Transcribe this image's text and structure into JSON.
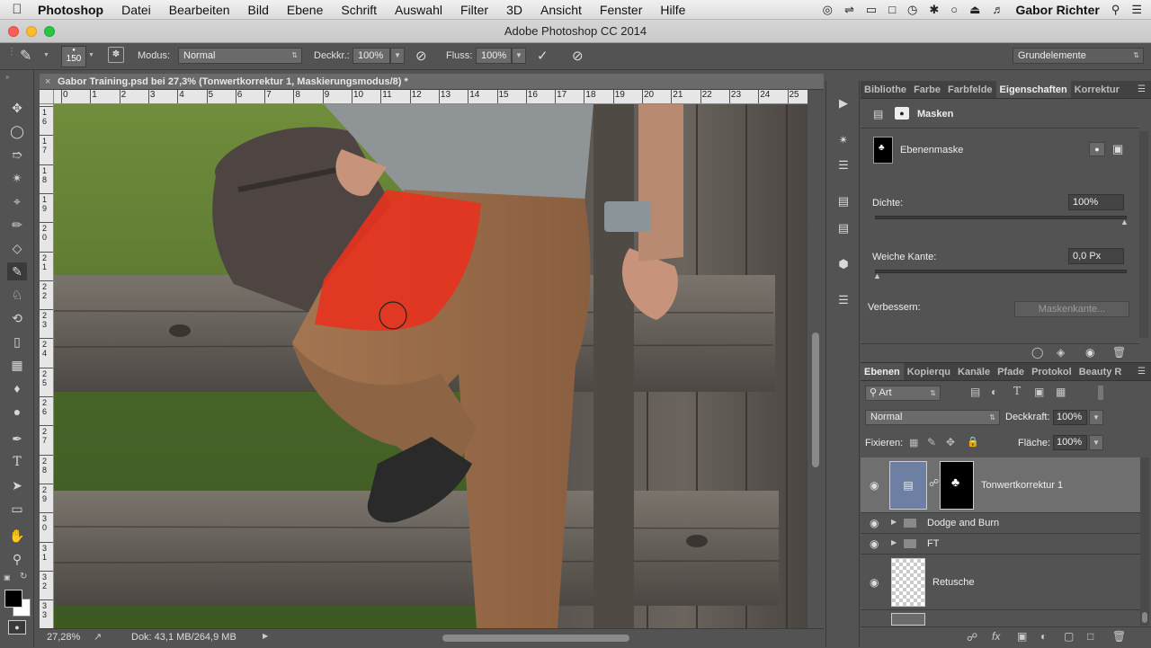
{
  "menubar": {
    "app": "Photoshop",
    "items": [
      "Datei",
      "Bearbeiten",
      "Bild",
      "Ebene",
      "Schrift",
      "Auswahl",
      "Filter",
      "3D",
      "Ansicht",
      "Fenster",
      "Hilfe"
    ],
    "user": "Gabor Richter"
  },
  "window": {
    "title": "Adobe Photoshop CC 2014"
  },
  "options": {
    "brush_size": "150",
    "modus_label": "Modus:",
    "modus_value": "Normal",
    "deckkr_label": "Deckkr.:",
    "deckkr_value": "100%",
    "fluss_label": "Fluss:",
    "fluss_value": "100%",
    "workspace": "Grundelemente"
  },
  "document": {
    "tab_title": "Gabor Training.psd bei 27,3% (Tonwertkorrektur 1, Maskierungsmodus/8) *",
    "ruler_h_labels": [
      "0",
      "1",
      "2",
      "3",
      "4",
      "5",
      "6",
      "7",
      "8",
      "9",
      "10",
      "11",
      "12",
      "13",
      "14",
      "15",
      "16",
      "17",
      "18",
      "19",
      "20",
      "21",
      "22",
      "23",
      "24",
      "25"
    ],
    "ruler_v_labels": [
      "16",
      "17",
      "18",
      "19",
      "20",
      "21",
      "22",
      "23",
      "24",
      "25",
      "26",
      "27",
      "28",
      "29",
      "30",
      "31",
      "32",
      "33"
    ]
  },
  "status": {
    "zoom": "27,28%",
    "doc": "Dok: 43,1 MB/264,9 MB"
  },
  "properties": {
    "tabs": [
      "Bibliothe",
      "Farbe",
      "Farbfelde",
      "Eigenschaften",
      "Korrektur"
    ],
    "active_tab": "Eigenschaften",
    "section": "Masken",
    "mask_label": "Ebenenmaske",
    "density_label": "Dichte:",
    "density_value": "100%",
    "density_fraction": 1.0,
    "feather_label": "Weiche Kante:",
    "feather_value": "0,0 Px",
    "feather_fraction": 0.0,
    "refine_label": "Verbessern:",
    "refine_button": "Maskenkante..."
  },
  "layers_panel": {
    "tabs": [
      "Ebenen",
      "Kopierqu",
      "Kanäle",
      "Pfade",
      "Protokol",
      "Beauty R"
    ],
    "active_tab": "Ebenen",
    "filter_value": "Art",
    "blend_mode": "Normal",
    "opacity_label": "Deckkraft:",
    "opacity_value": "100%",
    "lock_label": "Fixieren:",
    "fill_label": "Fläche:",
    "fill_value": "100%",
    "layers": [
      {
        "name": "Tonwertkorrektur 1",
        "selected": true
      },
      {
        "name": "Dodge and Burn",
        "type": "group"
      },
      {
        "name": "FT",
        "type": "group"
      },
      {
        "name": "Retusche",
        "type": "pixel"
      }
    ]
  },
  "colors": {
    "ui_bg": "#535353",
    "mask_overlay": "#e8321e",
    "selection": "#6f6f6f"
  }
}
